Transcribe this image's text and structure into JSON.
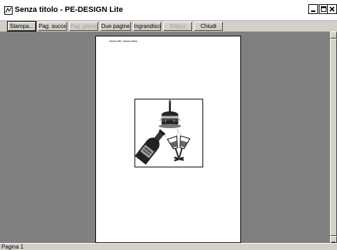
{
  "window": {
    "title": "Senza titolo - PE-DESIGN Lite",
    "icon": "app-icon"
  },
  "toolbar": {
    "buttons": [
      {
        "label": "Stampa...",
        "enabled": true
      },
      {
        "label": "Pag. succes.",
        "enabled": true
      },
      {
        "label": "Pag. preced.",
        "enabled": false
      },
      {
        "label": "Due pagine",
        "enabled": true
      },
      {
        "label": "Ingrandisci",
        "enabled": true
      },
      {
        "label": "Riduci",
        "enabled": false
      },
      {
        "label": "Chiudi",
        "enabled": true
      }
    ]
  },
  "page": {
    "header": "Nome file: Senza titolo",
    "design": [
      "cake-icon",
      "wine-bottle-icon",
      "champagne-glasses-icon"
    ]
  },
  "statusbar": {
    "text": "Pagina 1"
  },
  "colors": {
    "preview_background": "#808080",
    "chrome": "#d4d0c8",
    "page": "#ffffff"
  }
}
